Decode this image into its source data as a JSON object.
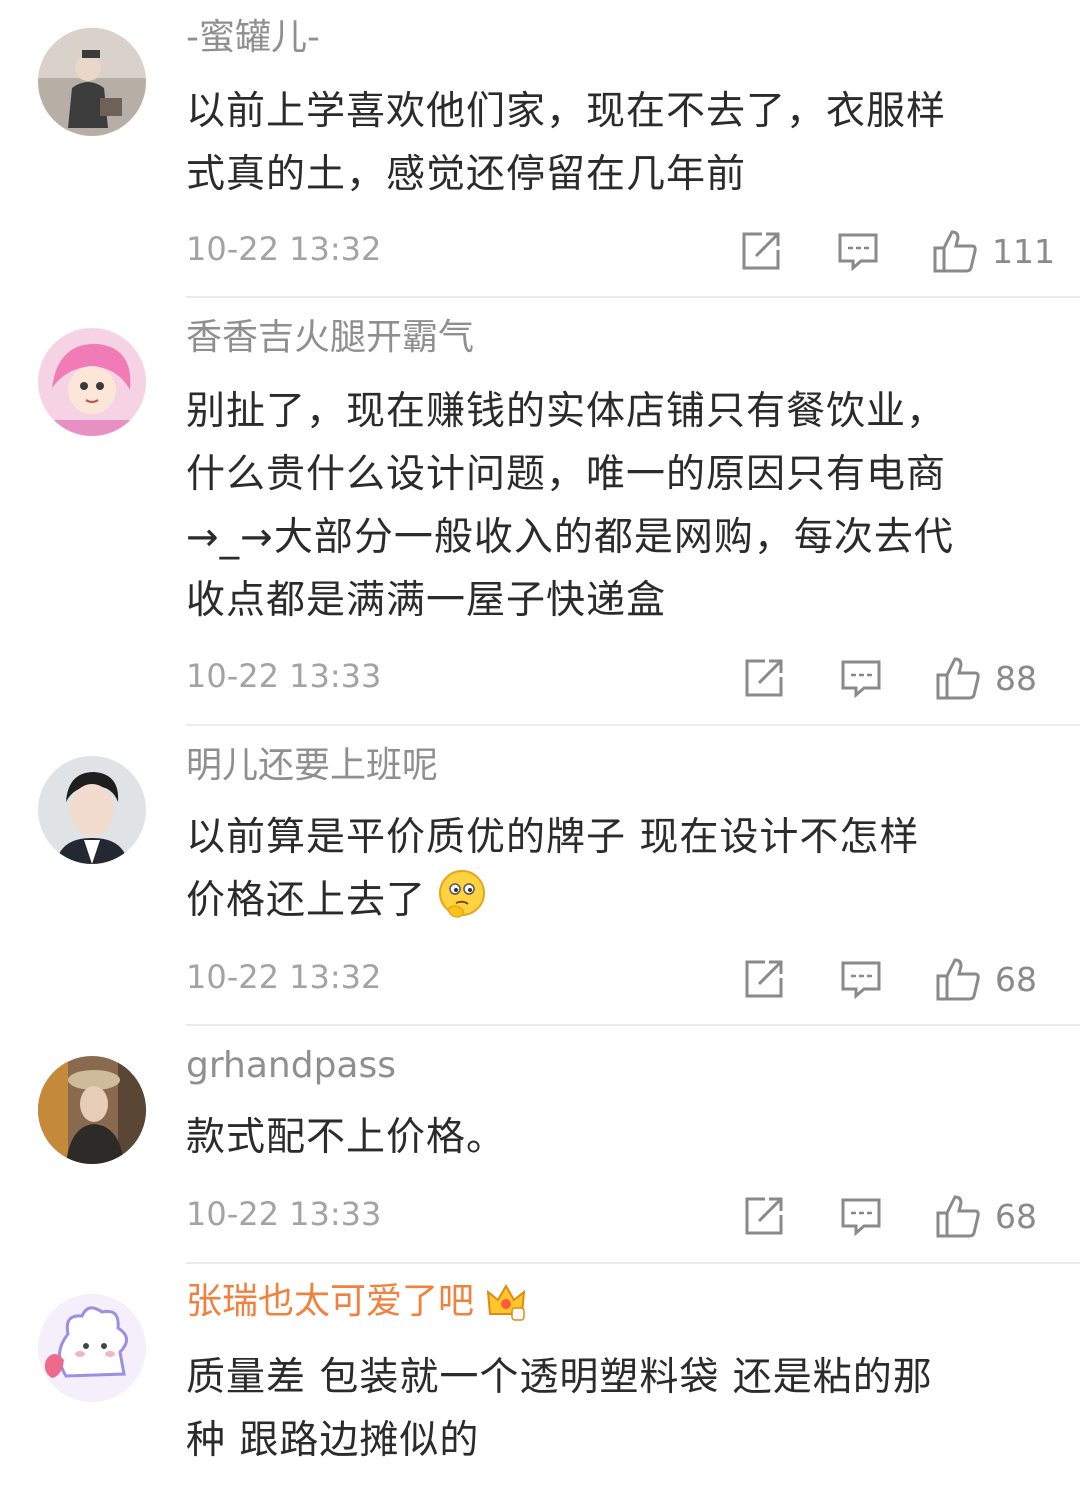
{
  "comments": [
    {
      "username": "-蜜罐儿-",
      "lines": [
        "以前上学喜欢他们家，现在不去了，衣服样",
        "式真的土，感觉还停留在几年前"
      ],
      "time": "10-22 13:32",
      "likes": "111"
    },
    {
      "username": "香香吉火腿开霸气",
      "lines": [
        "别扯了，现在赚钱的实体店铺只有餐饮业，",
        "什么贵什么设计问题，唯一的原因只有电商",
        "→_→大部分一般收入的都是网购，每次去代",
        "收点都是满满一屋子快递盒"
      ],
      "time": "10-22 13:33",
      "likes": "88"
    },
    {
      "username": "明儿还要上班呢",
      "lines": [
        "以前算是平价质优的牌子 现在设计不怎样",
        "价格还上去了"
      ],
      "time": "10-22 13:32",
      "likes": "68"
    },
    {
      "username": "grhandpass",
      "lines": [
        "款式配不上价格。"
      ],
      "time": "10-22 13:33",
      "likes": "68"
    },
    {
      "username": "张瑞也太可爱了吧",
      "lines": [
        "质量差 包装就一个透明塑料袋 还是粘的那",
        "种 跟路边摊似的"
      ]
    }
  ],
  "icons": {
    "repost": "share-icon",
    "comment": "comment-icon",
    "like": "thumbs-up-icon",
    "emoji": "thinking-face-emoji",
    "vip": "crown-badge-icon"
  },
  "colors": {
    "username": "#8f8f8f",
    "vip_username": "#f0813f",
    "text": "#2b2b2b",
    "meta": "#a3a3a3"
  }
}
